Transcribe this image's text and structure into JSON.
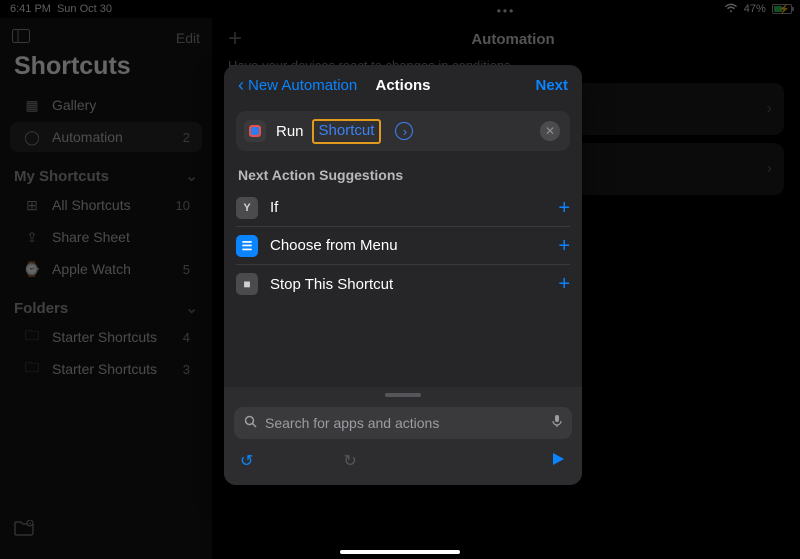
{
  "status": {
    "time": "6:41 PM",
    "date": "Sun Oct 30",
    "battery_pct": "47%"
  },
  "sidebar": {
    "edit": "Edit",
    "title": "Shortcuts",
    "items": [
      {
        "label": "Gallery",
        "badge": ""
      },
      {
        "label": "Automation",
        "badge": "2"
      }
    ],
    "section_my": "My Shortcuts",
    "my_items": [
      {
        "label": "All Shortcuts",
        "badge": "10"
      },
      {
        "label": "Share Sheet",
        "badge": ""
      },
      {
        "label": "Apple Watch",
        "badge": "5"
      }
    ],
    "section_folders": "Folders",
    "folders": [
      {
        "label": "Starter Shortcuts",
        "badge": "4"
      },
      {
        "label": "Starter Shortcuts",
        "badge": "3"
      }
    ]
  },
  "main": {
    "title": "Automation",
    "subtitle": "Have your devices react to changes in conditions."
  },
  "modal": {
    "back": "New Automation",
    "title": "Actions",
    "next": "Next",
    "run_label": "Run",
    "run_token": "Shortcut",
    "section": "Next Action Suggestions",
    "suggestions": [
      {
        "label": "If"
      },
      {
        "label": "Choose from Menu"
      },
      {
        "label": "Stop This Shortcut"
      }
    ],
    "search_placeholder": "Search for apps and actions"
  }
}
